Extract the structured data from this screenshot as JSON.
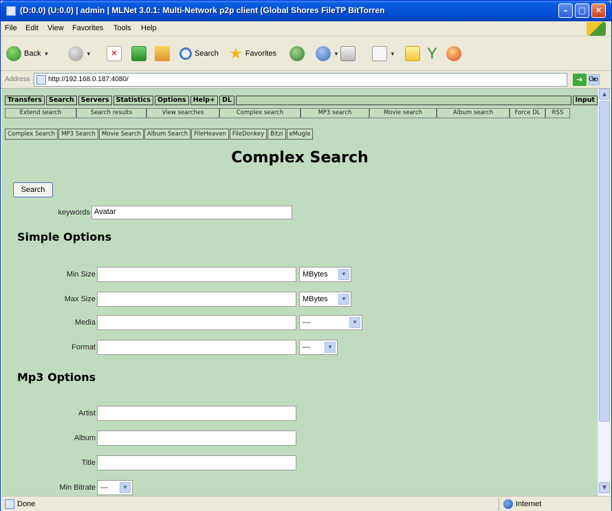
{
  "window": {
    "title": "(D:0.0) (U:0.0) | admin | MLNet 3.0.1: Multi-Network p2p client (Global Shores FileTP BitTorren",
    "min_icon": "minimize-icon",
    "max_icon": "maximize-icon",
    "close_icon": "close-icon",
    "close_glyph": "✕"
  },
  "menu": {
    "items": [
      "File",
      "Edit",
      "View",
      "Favorites",
      "Tools",
      "Help"
    ]
  },
  "toolbar": {
    "back": "Back",
    "search": "Search",
    "favorites": "Favorites"
  },
  "address": {
    "label": "Address",
    "url": "http://192.168.0.187:4080/",
    "go": "Go"
  },
  "nav": {
    "main": [
      "Transfers",
      "Search",
      "Servers",
      "Statistics",
      "Options",
      "Help+",
      "DL"
    ],
    "input": "Input",
    "sub": [
      "Extend search",
      "Search results",
      "View searches",
      "Complex search",
      "MP3 search",
      "Movie search",
      "Album search",
      "Force DL",
      "RSS"
    ],
    "search_tabs": [
      "Complex Search",
      "MP3 Search",
      "Movie Search",
      "Album Search",
      "FileHeaven",
      "FileDonkey",
      "Bitzi",
      "eMugle"
    ]
  },
  "page": {
    "title": "Complex Search",
    "search_button": "Search",
    "keywords_label": "keywords",
    "keywords_value": "Avatar",
    "simple_options": "Simple Options",
    "min_size_label": "Min Size",
    "max_size_label": "Max Size",
    "media_label": "Media",
    "format_label": "Format",
    "unit_value": "MBytes",
    "unit_value2": "MBytes",
    "media_value": "---",
    "format_value": "---",
    "mp3_options": "Mp3 Options",
    "artist_label": "Artist",
    "album_label": "Album",
    "title_label": "Title",
    "min_bitrate_label": "Min Bitrate",
    "min_bitrate_value": "---"
  },
  "status": {
    "text": "Done",
    "zone": "Internet"
  }
}
